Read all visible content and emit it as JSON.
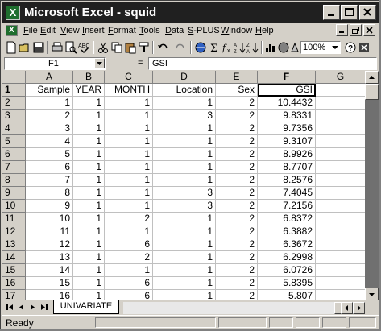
{
  "window": {
    "title": "Microsoft Excel - squid",
    "app_icon_letter": "X"
  },
  "menu": [
    "File",
    "Edit",
    "View",
    "Insert",
    "Format",
    "Tools",
    "Data",
    "S-PLUS",
    "Window",
    "Help"
  ],
  "toolbar": {
    "zoom": "100%",
    "icons": [
      "new-icon",
      "open-icon",
      "save-icon",
      "print-icon",
      "print-preview-icon",
      "spelling-icon",
      "cut-icon",
      "copy-icon",
      "paste-icon",
      "format-painter-icon",
      "undo-icon",
      "redo-icon",
      "hyperlink-icon",
      "autosum-icon",
      "function-icon",
      "sort-ascending-icon",
      "sort-descending-icon",
      "chart-wizard-icon",
      "map-icon",
      "drawing-icon",
      "zoom-dropdown-icon",
      "help-icon",
      "more-buttons-icon"
    ]
  },
  "formula_bar": {
    "name_box": "F1",
    "equals": "=",
    "content": "GSI"
  },
  "sheet": {
    "columns": [
      "A",
      "B",
      "C",
      "D",
      "E",
      "F",
      "G"
    ],
    "active_column": "F",
    "active_row": "1",
    "headers": [
      "Sample",
      "YEAR",
      "MONTH",
      "Location",
      "Sex",
      "GSI"
    ],
    "rows": [
      {
        "num": "1",
        "cells": [
          "Sample",
          "YEAR",
          "MONTH",
          "Location",
          "Sex",
          "GSI",
          ""
        ]
      },
      {
        "num": "2",
        "cells": [
          "1",
          "1",
          "1",
          "1",
          "2",
          "10.4432",
          ""
        ]
      },
      {
        "num": "3",
        "cells": [
          "2",
          "1",
          "1",
          "3",
          "2",
          "9.8331",
          ""
        ]
      },
      {
        "num": "4",
        "cells": [
          "3",
          "1",
          "1",
          "1",
          "2",
          "9.7356",
          ""
        ]
      },
      {
        "num": "5",
        "cells": [
          "4",
          "1",
          "1",
          "1",
          "2",
          "9.3107",
          ""
        ]
      },
      {
        "num": "6",
        "cells": [
          "5",
          "1",
          "1",
          "1",
          "2",
          "8.9926",
          ""
        ]
      },
      {
        "num": "7",
        "cells": [
          "6",
          "1",
          "1",
          "1",
          "2",
          "8.7707",
          ""
        ]
      },
      {
        "num": "8",
        "cells": [
          "7",
          "1",
          "1",
          "1",
          "2",
          "8.2576",
          ""
        ]
      },
      {
        "num": "9",
        "cells": [
          "8",
          "1",
          "1",
          "3",
          "2",
          "7.4045",
          ""
        ]
      },
      {
        "num": "10",
        "cells": [
          "9",
          "1",
          "1",
          "3",
          "2",
          "7.2156",
          ""
        ]
      },
      {
        "num": "11",
        "cells": [
          "10",
          "1",
          "2",
          "1",
          "2",
          "6.8372",
          ""
        ]
      },
      {
        "num": "12",
        "cells": [
          "11",
          "1",
          "1",
          "1",
          "2",
          "6.3882",
          ""
        ]
      },
      {
        "num": "13",
        "cells": [
          "12",
          "1",
          "6",
          "1",
          "2",
          "6.3672",
          ""
        ]
      },
      {
        "num": "14",
        "cells": [
          "13",
          "1",
          "2",
          "1",
          "2",
          "6.2998",
          ""
        ]
      },
      {
        "num": "15",
        "cells": [
          "14",
          "1",
          "1",
          "1",
          "2",
          "6.0726",
          ""
        ]
      },
      {
        "num": "16",
        "cells": [
          "15",
          "1",
          "6",
          "1",
          "2",
          "5.8395",
          ""
        ]
      },
      {
        "num": "17",
        "cells": [
          "16",
          "1",
          "6",
          "1",
          "2",
          "5.807",
          ""
        ]
      }
    ]
  },
  "sheet_tabs": [
    "UNIVARIATE"
  ],
  "status": "Ready"
}
